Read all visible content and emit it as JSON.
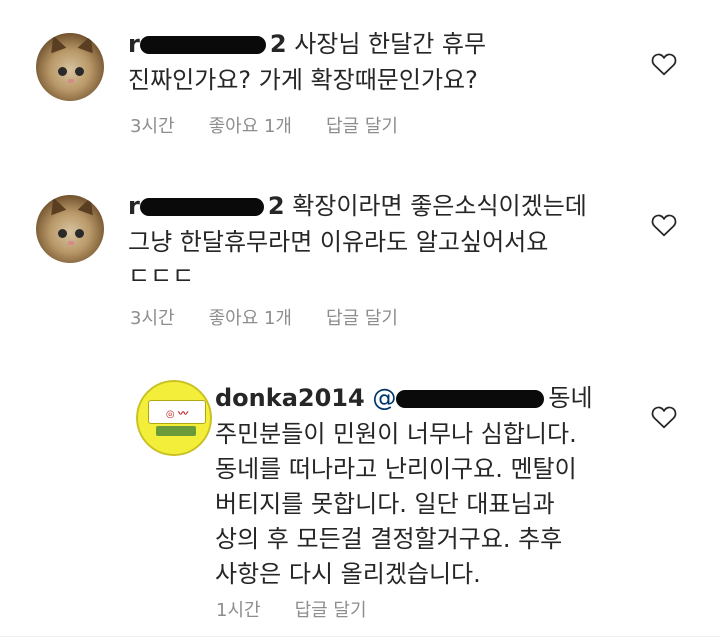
{
  "comments": [
    {
      "username": "r",
      "username_tail": "2",
      "line1": "사장님 한달간 휴무",
      "line2": "진짜인가요? 가게 확장때문인가요?",
      "line3": "",
      "time": "3시간",
      "likes": "좋아요 1개",
      "reply": "답글 달기"
    },
    {
      "username": "r",
      "username_tail": "2",
      "line1": "확장이라면 좋은소식이겠는데",
      "line2": "그냥 한달휴무라면 이유라도 알고싶어서요",
      "line3": "ㄷㄷㄷ",
      "time": "3시간",
      "likes": "좋아요 1개",
      "reply": "답글 달기"
    },
    {
      "username": "donka2014",
      "mention": "@",
      "line1": "동네",
      "line2": "주민분들이 민원이 너무나 심합니다.",
      "line3": "동네를 떠나라고 난리이구요. 멘탈이",
      "line4": "버티지를 못합니다. 일단 대표님과",
      "line5": "상의 후 모든걸 결정할거구요. 추후",
      "line6": "사항은 다시 올리겠습니다.",
      "time": "1시간",
      "reply": "답글 달기"
    }
  ],
  "icons": {
    "like": "heart-outline-icon"
  },
  "colors": {
    "meta": "#8e8e8e",
    "mention": "#003569"
  }
}
